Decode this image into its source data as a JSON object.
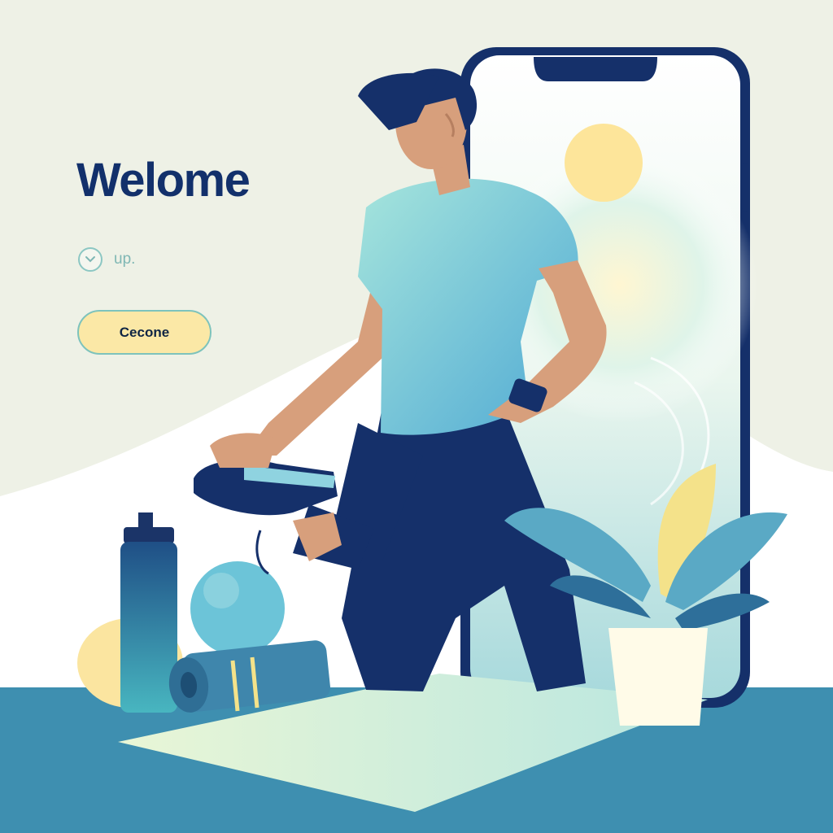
{
  "hero": {
    "title": "Welome",
    "secondary_link": "up.",
    "cta_label": "Cecone"
  },
  "icons": {
    "secondary_link_icon": "chevron-down-icon"
  },
  "colors": {
    "title": "#12306b",
    "cta_background": "#fbe8a6",
    "cta_border": "#7dc3bc",
    "accent_teal": "#5bc0c2",
    "shirt": "#6cc4d8",
    "pants": "#122b59",
    "floor": "#3e8fb0",
    "background": "#eef1e6"
  }
}
